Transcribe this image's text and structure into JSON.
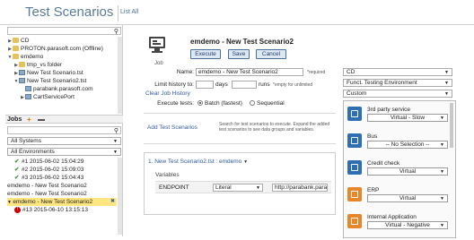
{
  "header": {
    "title": "Test Scenarios",
    "list_all": "List All"
  },
  "tree": [
    {
      "indent": 0,
      "twist": "▶",
      "icon": "folder",
      "label": "CD"
    },
    {
      "indent": 0,
      "twist": "▶",
      "icon": "folder",
      "label": "PROTON.parasoft.com (Offline)"
    },
    {
      "indent": 0,
      "twist": "▼",
      "icon": "folder",
      "label": "emdemo"
    },
    {
      "indent": 1,
      "twist": "▶",
      "icon": "folder",
      "label": "tmp_vs folder"
    },
    {
      "indent": 1,
      "twist": "▶",
      "icon": "file",
      "label": "New Test Scenario.tst"
    },
    {
      "indent": 1,
      "twist": "▼",
      "icon": "file",
      "label": "New Test Scenario2.tst"
    },
    {
      "indent": 2,
      "twist": "",
      "icon": "file",
      "label": "parabank.parasoft.com"
    },
    {
      "indent": 2,
      "twist": "▶",
      "icon": "file",
      "label": "CartServicePort"
    }
  ],
  "jobs": {
    "label": "Jobs",
    "plus": "+",
    "filter1": "All Systems",
    "filter2": "All Environments",
    "rows": [
      {
        "status": "ok",
        "text": "#1 2015-06-02 15:04:29"
      },
      {
        "status": "ok",
        "text": "#2 2015-06-02 15:09:03"
      },
      {
        "status": "ok",
        "text": "#3 2015-06-02 15:04:43"
      },
      {
        "status": "none",
        "text": "emdemo - New Test Scenario2"
      },
      {
        "status": "none",
        "text": "emdemo - New Test Scenario2"
      },
      {
        "status": "selected",
        "text": "emdemo - New Test Scenario2"
      },
      {
        "status": "err",
        "text": "#13 2015-06-10 13:15:13"
      }
    ]
  },
  "main": {
    "job_label": "Job",
    "scenario_title": "emdemo - New Test Scenario2",
    "execute": "Execute",
    "save": "Save",
    "cancel": "Cancel",
    "name_label": "Name:",
    "name_value": "emdemo - New Test Scenario2",
    "required": "*required",
    "limit_label": "Limit history to:",
    "days": "days",
    "runs": "runs",
    "empty_note": "*empty for unlimited",
    "clear_history": "Clear Job History",
    "execute_tests": "Execute tests:",
    "batch": "Batch (fastest)",
    "sequential": "Sequential",
    "add_tests": "Add Test Scenarios",
    "add_note": "Search for test scenarios to execute. Expand the added test scenarios to see data groups and variables.",
    "scenario_row": "1. New Test Scenario2.tst : emdemo",
    "variables": "Variables",
    "endpoint": "ENDPOINT",
    "literal": "Literal",
    "endpoint_value": "http://parabank.para"
  },
  "right": {
    "selects": [
      "CD",
      "Funct. Testing Environment",
      "Custom"
    ],
    "services": [
      {
        "name": "3rd party service",
        "value": "Virtual - Slow",
        "color": "#2d6fb5"
      },
      {
        "name": "Bus",
        "value": "-- No Selection --",
        "color": "#2d6fb5"
      },
      {
        "name": "Credit check",
        "value": "Virtual",
        "color": "#2d6fb5"
      },
      {
        "name": "ERP",
        "value": "Virtual",
        "color": "#e8862a"
      },
      {
        "name": "Internal Application",
        "value": "Virtual - Negative",
        "color": "#e8862a"
      }
    ]
  }
}
